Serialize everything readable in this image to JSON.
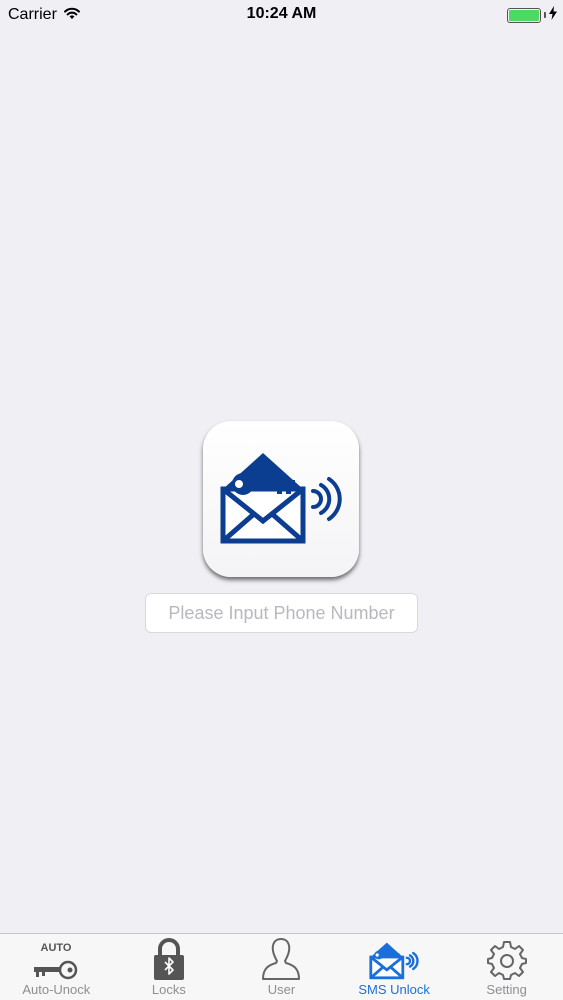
{
  "status_bar": {
    "carrier": "Carrier",
    "time": "10:24 AM",
    "icons": [
      "wifi-icon",
      "battery-icon",
      "charging-bolt-icon"
    ],
    "battery_color": "#4cd964"
  },
  "main": {
    "app_icon": "sms-unlock-envelope-key-icon",
    "brand_color": "#0b3d91",
    "phone_input": {
      "value": "",
      "placeholder": "Please Input Phone Number"
    }
  },
  "tab_bar": {
    "active_color": "#1a6fdc",
    "tabs": [
      {
        "label": "Auto-Unock",
        "icon": "auto-key-icon",
        "icon_text": "AUTO",
        "active": false
      },
      {
        "label": "Locks",
        "icon": "bluetooth-lock-icon",
        "active": false
      },
      {
        "label": "User",
        "icon": "user-icon",
        "active": false
      },
      {
        "label": "SMS Unlock",
        "icon": "sms-unlock-icon",
        "active": true
      },
      {
        "label": "Setting",
        "icon": "gear-icon",
        "active": false
      }
    ]
  }
}
